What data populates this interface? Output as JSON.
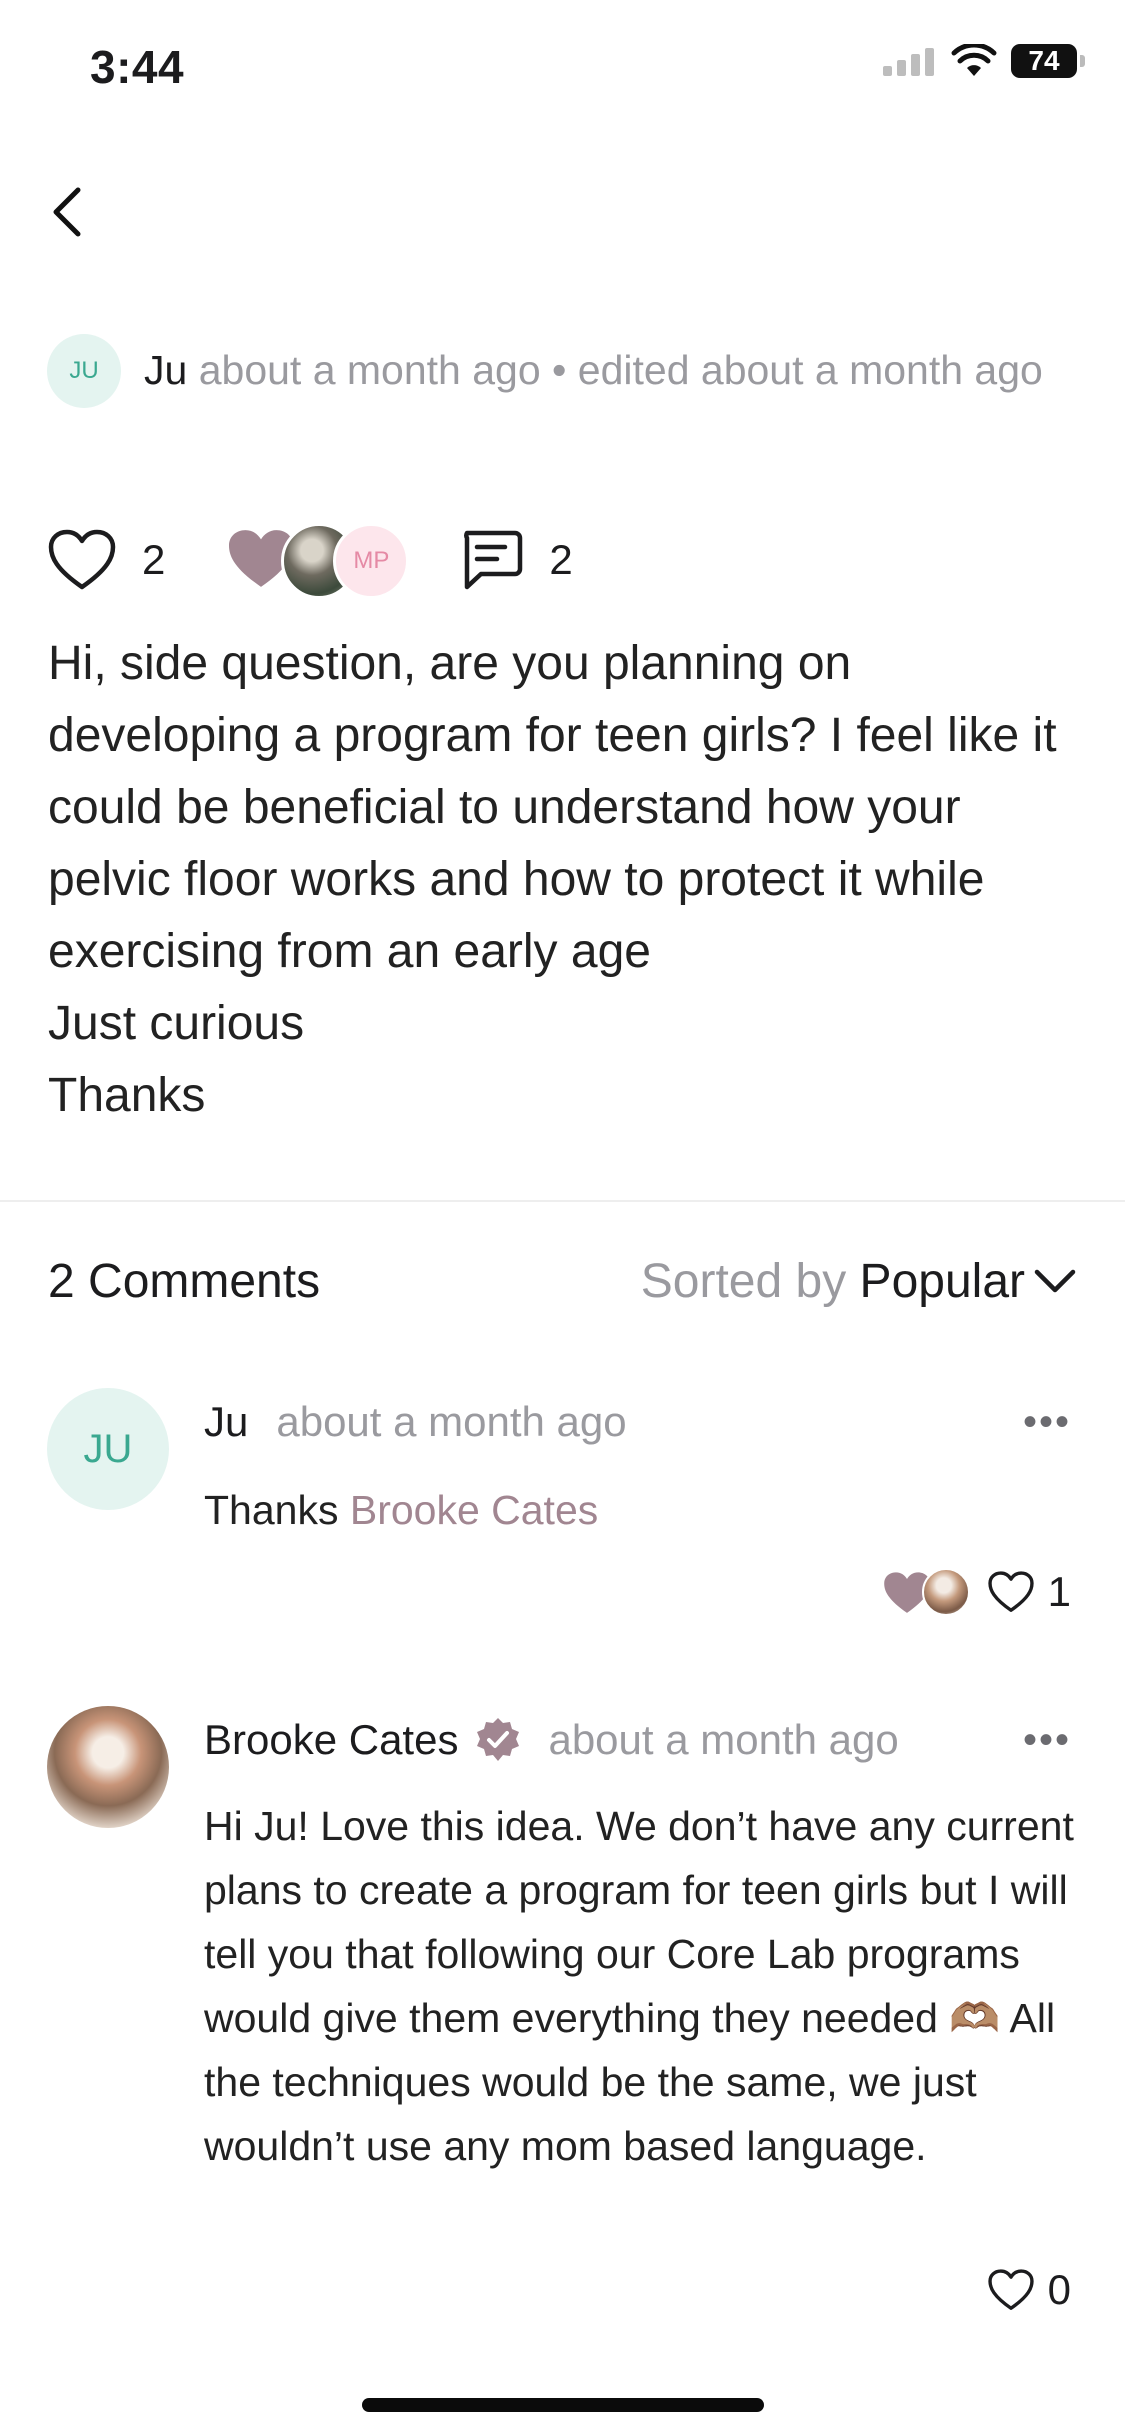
{
  "status_bar": {
    "time": "3:44",
    "battery": "74"
  },
  "post": {
    "avatar_initials": "JU",
    "author": "Ju",
    "meta": "about a month ago • edited about a month ago",
    "like_count": "2",
    "reactor_initials": "MP",
    "comment_count": "2",
    "body_lines": [
      "Hi, side question, are you planning on developing a program for teen girls? I feel like it could be beneficial to understand how your pelvic floor works and how to protect it while exercising from an early age",
      "Just curious",
      "Thanks"
    ]
  },
  "comments_header": {
    "title": "2 Comments",
    "sort_label": "Sorted by",
    "sort_value": "Popular"
  },
  "comments": [
    {
      "avatar_initials": "JU",
      "author": "Ju",
      "time": "about a month ago",
      "text_prefix": "Thanks ",
      "mention": "Brooke Cates",
      "like_count": "1",
      "more": "•••"
    },
    {
      "author": "Brooke Cates",
      "time": "about a month ago",
      "text": "Hi Ju! Love this idea. We don’t have any current plans to create a program for teen girls but I will tell you that following our Core Lab programs would give them everything they needed 🫶🏽  All the techniques would be the same, we just wouldn’t use any mom based language.",
      "like_count": "0",
      "more": "•••"
    }
  ],
  "colors": {
    "accent_mauve": "#a18691",
    "ju_avatar_bg": "#e4f4f0",
    "ju_avatar_text": "#3aa890",
    "muted_text": "#9a9a9f"
  }
}
